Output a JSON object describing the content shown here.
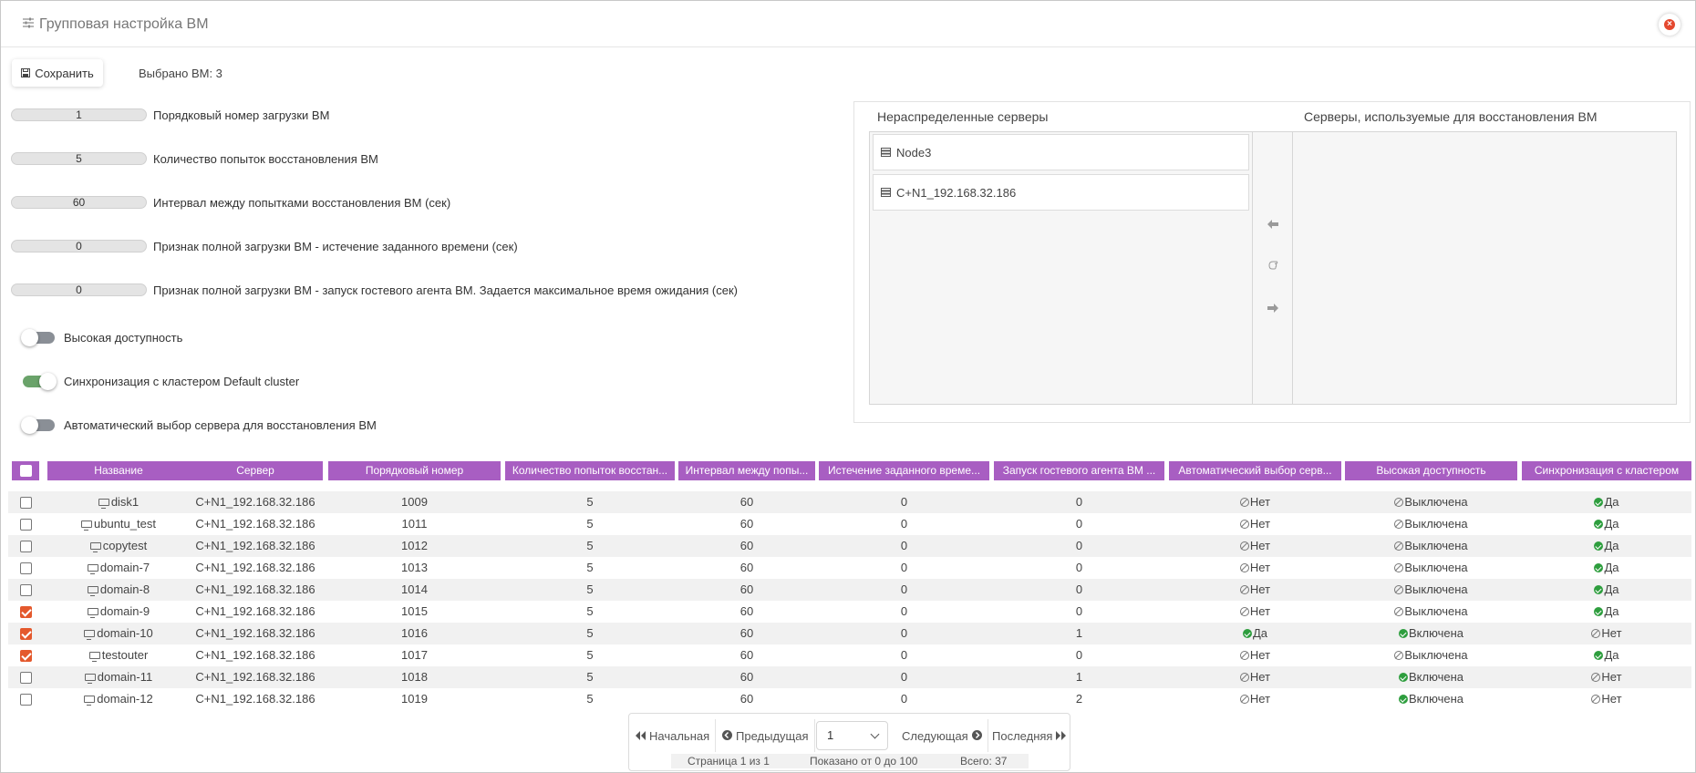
{
  "window": {
    "title": "Групповая настройка ВМ",
    "close_icon": "close-icon"
  },
  "toolbar": {
    "save_label": "Сохранить",
    "selected_count": "Выбрано ВМ: 3"
  },
  "params": [
    {
      "value": "1",
      "label": "Порядковый номер загрузки ВМ"
    },
    {
      "value": "5",
      "label": "Количество попыток восстановления ВМ"
    },
    {
      "value": "60",
      "label": "Интервал между попытками восстановления ВМ (сек)"
    },
    {
      "value": "0",
      "label": "Признак полной загрузки ВМ - истечение заданного времени (сек)"
    },
    {
      "value": "0",
      "label": "Признак полной загрузки ВМ - запуск гостевого агента ВМ. Задается максимальное время ожидания (сек)"
    }
  ],
  "toggles": [
    {
      "label": "Высокая доступность",
      "on": false
    },
    {
      "label": "Синхронизация с кластером Default cluster",
      "on": true
    },
    {
      "label": "Автоматический выбор сервера для восстановления ВМ",
      "on": false
    }
  ],
  "servers": {
    "unassigned_title": "Нераспределенные серверы",
    "assigned_title": "Серверы, используемые для восстановления ВМ",
    "unassigned": [
      "Node3",
      "C+N1_192.168.32.186"
    ],
    "assigned": []
  },
  "table": {
    "columns": [
      "Название",
      "Сервер",
      "Порядковый номер",
      "Количество попыток восстан...",
      "Интервал между попы...",
      "Истечение заданного време...",
      "Запуск гостевого агента ВМ ...",
      "Автоматический выбор серв...",
      "Высокая доступность",
      "Синхронизация с кластером"
    ],
    "rows": [
      {
        "checked": false,
        "name": "disk1",
        "server": "C+N1_192.168.32.186",
        "order": "1009",
        "attempts": "5",
        "interval": "60",
        "timeout": "0",
        "agent": "0",
        "auto": "Нет",
        "auto_ok": false,
        "ha": "Выключена",
        "ha_ok": false,
        "sync": "Да",
        "sync_ok": true
      },
      {
        "checked": false,
        "name": "ubuntu_test",
        "server": "C+N1_192.168.32.186",
        "order": "1011",
        "attempts": "5",
        "interval": "60",
        "timeout": "0",
        "agent": "0",
        "auto": "Нет",
        "auto_ok": false,
        "ha": "Выключена",
        "ha_ok": false,
        "sync": "Да",
        "sync_ok": true
      },
      {
        "checked": false,
        "name": "copytest",
        "server": "C+N1_192.168.32.186",
        "order": "1012",
        "attempts": "5",
        "interval": "60",
        "timeout": "0",
        "agent": "0",
        "auto": "Нет",
        "auto_ok": false,
        "ha": "Выключена",
        "ha_ok": false,
        "sync": "Да",
        "sync_ok": true
      },
      {
        "checked": false,
        "name": "domain-7",
        "server": "C+N1_192.168.32.186",
        "order": "1013",
        "attempts": "5",
        "interval": "60",
        "timeout": "0",
        "agent": "0",
        "auto": "Нет",
        "auto_ok": false,
        "ha": "Выключена",
        "ha_ok": false,
        "sync": "Да",
        "sync_ok": true
      },
      {
        "checked": false,
        "name": "domain-8",
        "server": "C+N1_192.168.32.186",
        "order": "1014",
        "attempts": "5",
        "interval": "60",
        "timeout": "0",
        "agent": "0",
        "auto": "Нет",
        "auto_ok": false,
        "ha": "Выключена",
        "ha_ok": false,
        "sync": "Да",
        "sync_ok": true
      },
      {
        "checked": true,
        "name": "domain-9",
        "server": "C+N1_192.168.32.186",
        "order": "1015",
        "attempts": "5",
        "interval": "60",
        "timeout": "0",
        "agent": "0",
        "auto": "Нет",
        "auto_ok": false,
        "ha": "Выключена",
        "ha_ok": false,
        "sync": "Да",
        "sync_ok": true
      },
      {
        "checked": true,
        "name": "domain-10",
        "server": "C+N1_192.168.32.186",
        "order": "1016",
        "attempts": "5",
        "interval": "60",
        "timeout": "0",
        "agent": "1",
        "auto": "Да",
        "auto_ok": true,
        "ha": "Включена",
        "ha_ok": true,
        "sync": "Нет",
        "sync_ok": false
      },
      {
        "checked": true,
        "name": "testouter",
        "server": "C+N1_192.168.32.186",
        "order": "1017",
        "attempts": "5",
        "interval": "60",
        "timeout": "0",
        "agent": "0",
        "auto": "Нет",
        "auto_ok": false,
        "ha": "Выключена",
        "ha_ok": false,
        "sync": "Да",
        "sync_ok": true
      },
      {
        "checked": false,
        "name": "domain-11",
        "server": "C+N1_192.168.32.186",
        "order": "1018",
        "attempts": "5",
        "interval": "60",
        "timeout": "0",
        "agent": "1",
        "auto": "Нет",
        "auto_ok": false,
        "ha": "Включена",
        "ha_ok": true,
        "sync": "Нет",
        "sync_ok": false
      },
      {
        "checked": false,
        "name": "domain-12",
        "server": "C+N1_192.168.32.186",
        "order": "1019",
        "attempts": "5",
        "interval": "60",
        "timeout": "0",
        "agent": "2",
        "auto": "Нет",
        "auto_ok": false,
        "ha": "Включена",
        "ha_ok": true,
        "sync": "Нет",
        "sync_ok": false
      }
    ]
  },
  "pager": {
    "first": "Начальная",
    "prev": "Предыдущая",
    "page": "1",
    "next": "Следующая",
    "last": "Последняя",
    "page_info": "Страница 1 из 1",
    "shown_info": "Показано от 0 до 100",
    "total_info": "Всего: 37"
  },
  "colors": {
    "header_purple": "#a85ec2",
    "checkbox_orange": "#e4592d",
    "ok_green": "#2e9e3e",
    "toggle_on": "#6aa36a"
  }
}
